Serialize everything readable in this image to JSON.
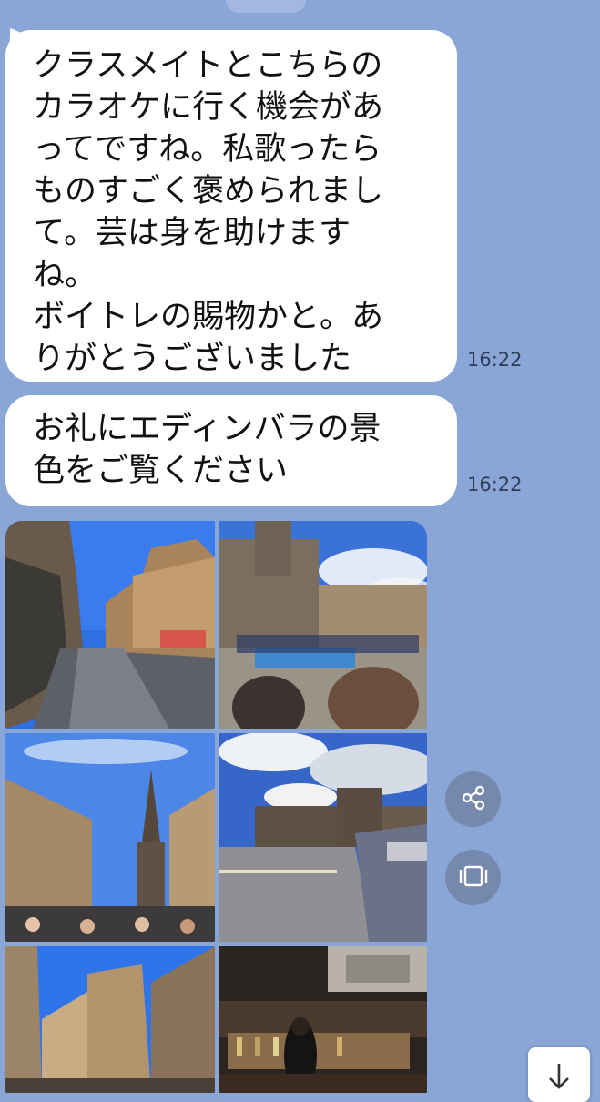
{
  "messages": [
    {
      "text": "クラスメイトとこちらの\nカラオケに行く機会があ\nってですね。私歌ったら\nものすごく褒められまし\nて。芸は身を助けます\nね。\nボイトレの賜物かと。あ\nりがとうございました",
      "time": "16:22"
    },
    {
      "text": "お礼にエディンバラの景\n色をご覧ください",
      "time": "16:22"
    }
  ],
  "photos": [
    "royal-mile-cobbled-street",
    "march-with-flags-near-cathedral",
    "tolbooth-spire-crowd",
    "north-bridge-street-view",
    "victoria-street-curved-buildings",
    "pub-interior"
  ],
  "icons": {
    "share": "share-icon",
    "frame": "carousel-icon",
    "scroll": "arrow-down-icon"
  },
  "colors": {
    "chat_background": "#8aa6d6",
    "bubble": "#ffffff",
    "action_button": "#7589ad"
  }
}
